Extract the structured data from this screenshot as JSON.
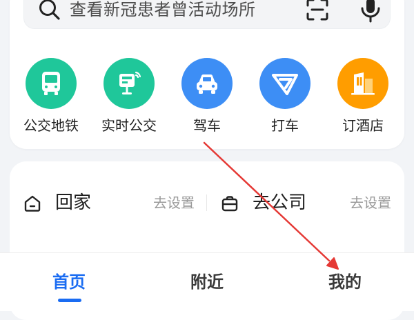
{
  "search": {
    "placeholder": "查看新冠患者曾活动场所",
    "icons": [
      "search-icon",
      "scan-icon",
      "microphone-icon"
    ]
  },
  "quick_actions": [
    {
      "label": "公交地铁",
      "icon": "bus-icon",
      "color": "#1fc79a"
    },
    {
      "label": "实时公交",
      "icon": "realtime-bus-stop-icon",
      "color": "#1fc79a"
    },
    {
      "label": "驾车",
      "icon": "car-icon",
      "color": "#3d8ef5"
    },
    {
      "label": "打车",
      "icon": "taxi-icon",
      "color": "#3d8ef5"
    },
    {
      "label": "订酒店",
      "icon": "hotel-icon",
      "color": "#ff9d00"
    }
  ],
  "shortcuts": {
    "home_label": "回家",
    "home_action": "去设置",
    "work_label": "去公司",
    "work_action": "去设置"
  },
  "tabs": [
    {
      "label": "首页",
      "active": true
    },
    {
      "label": "附近",
      "active": false
    },
    {
      "label": "我的",
      "active": false
    }
  ],
  "colors": {
    "accent": "#1a6cf2",
    "annotation": "#e53935"
  }
}
